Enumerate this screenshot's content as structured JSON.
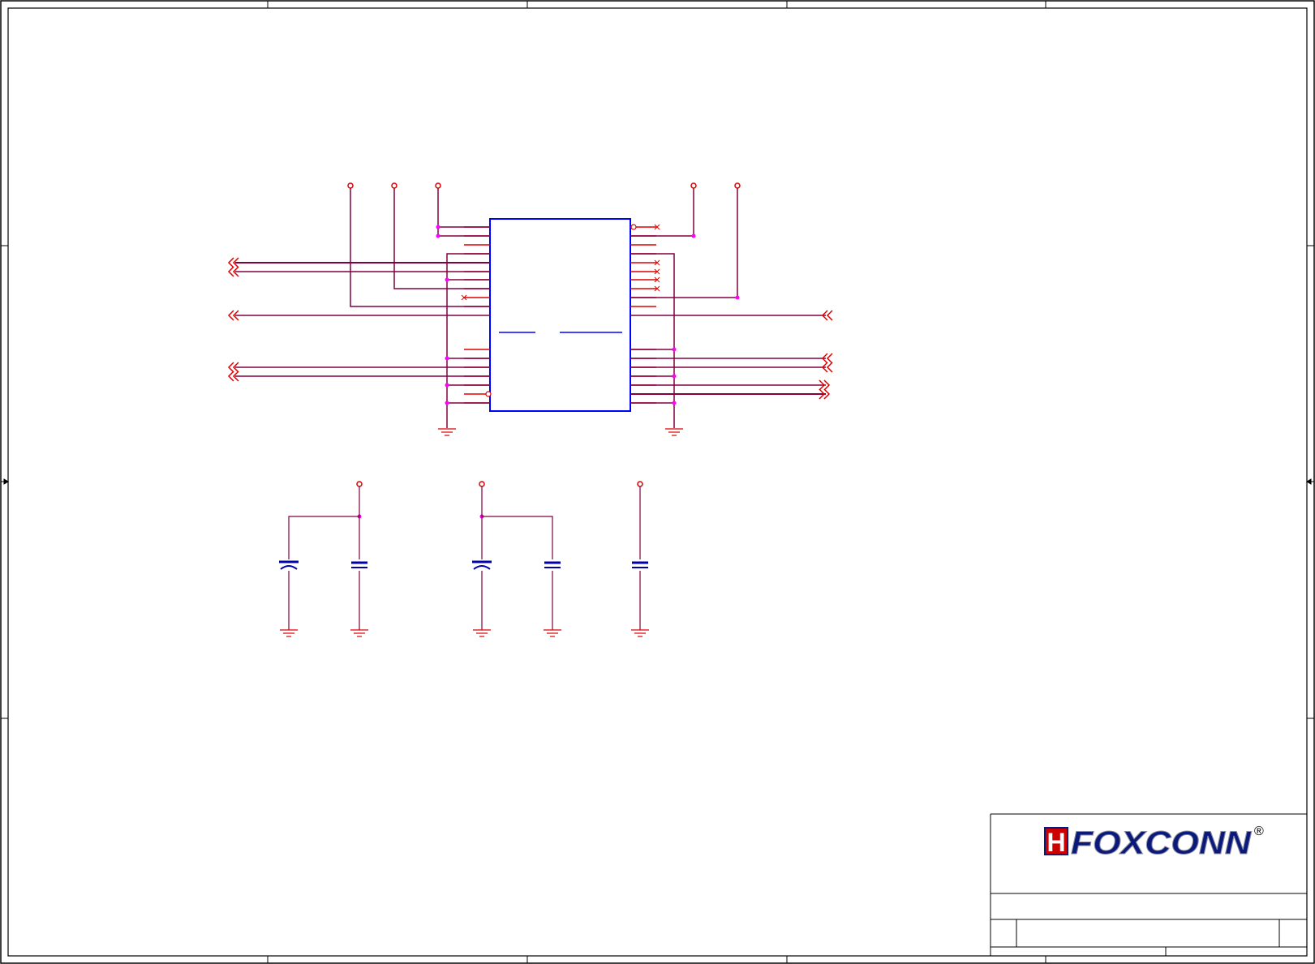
{
  "title_block": {
    "company_logo_text": "FOXCONN",
    "logo_h_letter": "H",
    "registered_mark": "®"
  },
  "colors": {
    "frame": "#000000",
    "ic_body": "#0000ff",
    "pin": "#dd0000",
    "wire": "#800040",
    "junction": "#ff00ff",
    "capacitor": "#0000aa",
    "logo_fill": "#0a1a7a",
    "logo_accent": "#cc0000"
  },
  "icons": {
    "power_port": "open-circle-icon",
    "ground": "ground-symbol-icon",
    "offpage_connector": "double-chevron-icon",
    "no_connect": "x-mark-icon",
    "junction": "junction-dot-icon"
  }
}
